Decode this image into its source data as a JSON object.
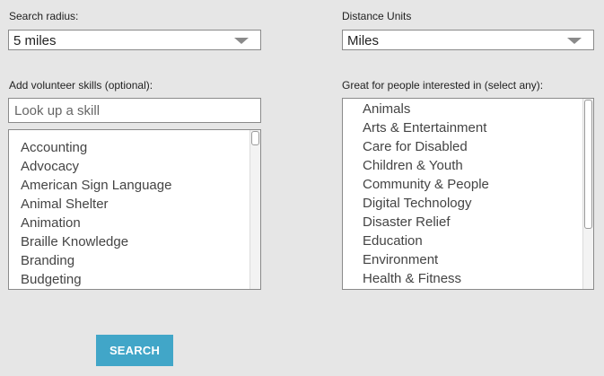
{
  "radius": {
    "label": "Search radius:",
    "value": "5 miles"
  },
  "units": {
    "label": "Distance Units",
    "value": "Miles"
  },
  "skills": {
    "label": "Add volunteer skills (optional):",
    "placeholder": "Look up a skill",
    "items": [
      "Accounting",
      "Advocacy",
      "American Sign Language",
      "Animal Shelter",
      "Animation",
      "Braille Knowledge",
      "Branding",
      "Budgeting"
    ]
  },
  "interests": {
    "label": "Great for people interested in (select any):",
    "items": [
      "Animals",
      "Arts & Entertainment",
      "Care for Disabled",
      "Children & Youth",
      "Community & People",
      "Digital Technology",
      "Disaster Relief",
      "Education",
      "Environment",
      "Health & Fitness"
    ]
  },
  "search_button": {
    "label": "SEARCH"
  },
  "colors": {
    "background": "#e6e6e6",
    "button": "#41a6c8",
    "border": "#8a8a8a"
  },
  "icons": {
    "dropdown": "chevron-down-icon"
  }
}
